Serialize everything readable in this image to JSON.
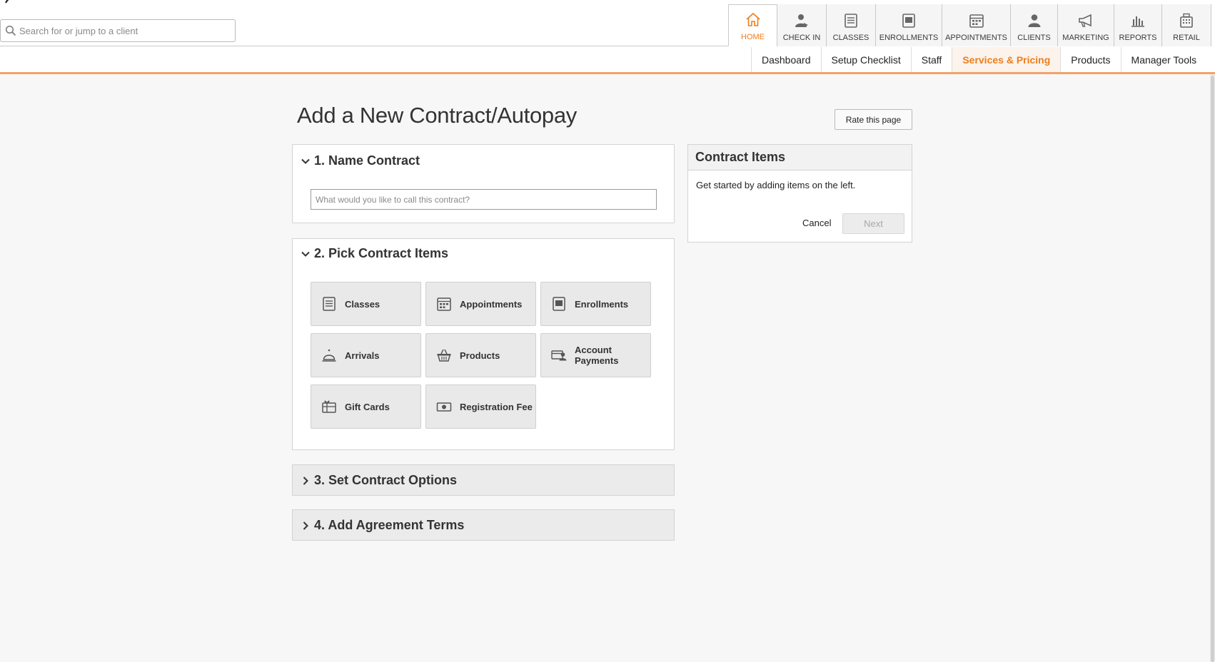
{
  "search": {
    "placeholder": "Search for or jump to a client"
  },
  "top_nav": [
    {
      "label": "HOME",
      "icon": "home-icon",
      "active": true
    },
    {
      "label": "CHECK IN",
      "icon": "check-in-icon"
    },
    {
      "label": "CLASSES",
      "icon": "classes-icon"
    },
    {
      "label": "ENROLLMENTS",
      "icon": "enrollments-icon"
    },
    {
      "label": "APPOINTMENTS",
      "icon": "appointments-icon"
    },
    {
      "label": "CLIENTS",
      "icon": "clients-icon"
    },
    {
      "label": "MARKETING",
      "icon": "megaphone-icon"
    },
    {
      "label": "REPORTS",
      "icon": "bar-chart-icon"
    },
    {
      "label": "RETAIL",
      "icon": "register-icon"
    }
  ],
  "sub_nav": [
    {
      "label": "Dashboard"
    },
    {
      "label": "Setup Checklist"
    },
    {
      "label": "Staff"
    },
    {
      "label": "Services & Pricing",
      "active": true
    },
    {
      "label": "Products"
    },
    {
      "label": "Manager Tools"
    }
  ],
  "page": {
    "title": "Add a New Contract/Autopay",
    "rate_button": "Rate this page"
  },
  "sections": {
    "name_contract": {
      "title": "1. Name Contract",
      "input_placeholder": "What would you like to call this contract?",
      "input_value": ""
    },
    "pick_items": {
      "title": "2. Pick Contract Items",
      "items": [
        {
          "label": "Classes",
          "icon": "classes-icon"
        },
        {
          "label": "Appointments",
          "icon": "appointments-icon"
        },
        {
          "label": "Enrollments",
          "icon": "enrollments-icon"
        },
        {
          "label": "Arrivals",
          "icon": "service-bell-icon"
        },
        {
          "label": "Products",
          "icon": "basket-icon"
        },
        {
          "label": "Account Payments",
          "icon": "account-payments-icon"
        },
        {
          "label": "Gift Cards",
          "icon": "gift-card-icon"
        },
        {
          "label": "Registration Fee",
          "icon": "cash-icon"
        }
      ]
    },
    "contract_options": {
      "title": "3. Set Contract Options"
    },
    "agreement_terms": {
      "title": "4. Add Agreement Terms"
    }
  },
  "contract_items_panel": {
    "title": "Contract Items",
    "empty_text": "Get started by adding items on the left.",
    "cancel_label": "Cancel",
    "next_label": "Next"
  },
  "colors": {
    "accent": "#ef7d1a",
    "accent_line": "#f2a266"
  }
}
